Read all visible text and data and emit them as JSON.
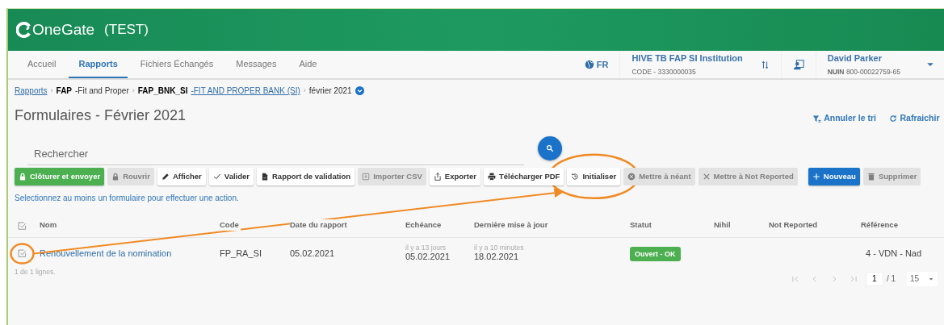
{
  "app": {
    "logo": "OneGate",
    "environment": "(TEST)"
  },
  "nav": {
    "tabs": [
      {
        "label": "Accueil",
        "selected": false
      },
      {
        "label": "Rapports",
        "selected": true
      },
      {
        "label": "Fichiers Échangés",
        "selected": false
      },
      {
        "label": "Messages",
        "selected": false
      },
      {
        "label": "Aide",
        "selected": false
      }
    ],
    "language": "FR",
    "institution": {
      "name": "HIVE TB FAP SI Institution",
      "code": "CODE - 3330000035"
    },
    "user": {
      "name": "David Parker",
      "id": "**NUIN** 800-00022759-65"
    }
  },
  "breadcrumb": [
    {
      "label": "Rapports",
      "link": true
    },
    {
      "separator": "›",
      "code": "FAP",
      "label": "-Fit and Proper",
      "link": false
    },
    {
      "separator": "›",
      "code": "FAP_BNK_SI",
      "label": "-FIT AND PROPER BANK (SI)",
      "link": true
    },
    {
      "separator": "›",
      "label": "février 2021",
      "link": false,
      "dropdown": true
    }
  ],
  "page": {
    "title": "Formulaires - Février 2021",
    "actions": [
      "Annuler le tri",
      "Rafraichir"
    ]
  },
  "search": {
    "placeholder": "Rechercher"
  },
  "toolbar": [
    {
      "label": "Clôturer et envoyer",
      "kind": "success",
      "disabled": false,
      "highlighted": false
    },
    {
      "label": "Rouvrir",
      "kind": "default",
      "disabled": true,
      "highlighted": false
    },
    {
      "label": "Afficher",
      "kind": "default",
      "disabled": false,
      "highlighted": false
    },
    {
      "label": "Valider",
      "kind": "default",
      "disabled": false,
      "highlighted": false
    },
    {
      "label": "Rapport de validation",
      "kind": "default",
      "disabled": false,
      "highlighted": false
    },
    {
      "label": "Importer CSV",
      "kind": "default",
      "disabled": true,
      "highlighted": false
    },
    {
      "label": "Exporter",
      "kind": "default",
      "disabled": false,
      "highlighted": false
    },
    {
      "label": "Télécharger PDF",
      "kind": "default",
      "disabled": false,
      "highlighted": false
    },
    {
      "label": "Initialiser",
      "kind": "default",
      "disabled": false,
      "highlighted": true
    },
    {
      "label": "Mettre à néant",
      "kind": "default",
      "disabled": true,
      "highlighted": false
    },
    {
      "label": "Mettre à Not Reported",
      "kind": "default",
      "disabled": true,
      "highlighted": false
    },
    {
      "label": "Nouveau",
      "kind": "primary",
      "disabled": false,
      "highlighted": false
    },
    {
      "label": "Supprimer",
      "kind": "default",
      "disabled": true,
      "highlighted": false
    }
  ],
  "hint": "Selectionnez au moins un formulaire pour effectuer une action.",
  "table": {
    "columns": [
      "Nom",
      "Code",
      "Date du rapport",
      "Echéance",
      "Dernière mise à jour",
      "Statut",
      "Nihil",
      "Not Reported",
      "Référence"
    ],
    "rows": [
      {
        "checked": false,
        "highlighted": true,
        "name": "Renouvellement de la nomination",
        "code": "FP_RA_SI",
        "report_date": "05.02.2021",
        "due": {
          "relative": "il y a 13 jours",
          "date": "05.02.2021"
        },
        "updated": {
          "relative": "il y a 10 minutes",
          "date": "18.02.2021"
        },
        "status": {
          "label": "Ouvert - OK",
          "color": "#4caf50"
        },
        "reference": "4 - VDN - Nad"
      }
    ]
  },
  "footer": {
    "count": "1 de 1 lignes.",
    "page": "1",
    "pages": "/ 1",
    "page_size": "15"
  }
}
